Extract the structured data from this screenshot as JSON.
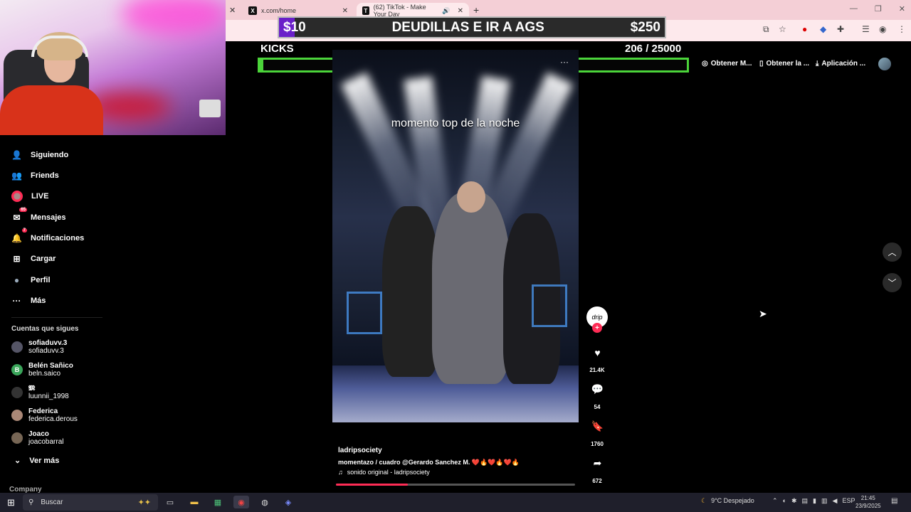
{
  "browser": {
    "tabs": [
      {
        "title": "x.com/home",
        "icon": "X"
      },
      {
        "title": "(62) TikTok - Make Your Day",
        "icon": "T"
      }
    ],
    "new_tab": "+",
    "close_side": "✕"
  },
  "donation_bar": {
    "left": "$10",
    "goal_text": "DEUDILLAS E IR A AGS",
    "right": "$250",
    "progress": 0.04
  },
  "kicks": {
    "label": "KICKS",
    "count": "206  / 25000",
    "progress": 0.008
  },
  "sidebar": {
    "items": [
      {
        "label": "Siguiendo",
        "icon": "person-icon",
        "glyph": "👤"
      },
      {
        "label": "Friends",
        "icon": "people-icon",
        "glyph": "👥"
      },
      {
        "label": "LIVE",
        "icon": "live-icon",
        "glyph": ""
      },
      {
        "label": "Mensajes",
        "icon": "message-icon",
        "glyph": "✉",
        "badge": "65"
      },
      {
        "label": "Notificaciones",
        "icon": "notification-icon",
        "glyph": "🔔",
        "badge": "7"
      },
      {
        "label": "Cargar",
        "icon": "upload-icon",
        "glyph": "⊞"
      },
      {
        "label": "Perfil",
        "icon": "profile-icon",
        "glyph": "●"
      },
      {
        "label": "Más",
        "icon": "more-icon",
        "glyph": "···"
      }
    ],
    "following_title": "Cuentas que sigues",
    "accounts": [
      {
        "name": "sofiaduvv.3",
        "handle": "sofiaduvv.3",
        "initial": ""
      },
      {
        "name": "Belén Sañico",
        "handle": "beln.saico",
        "initial": "B"
      },
      {
        "name": "𝕸",
        "handle": "luunnii_1998",
        "initial": ""
      },
      {
        "name": "Federica",
        "handle": "federica.derous",
        "initial": ""
      },
      {
        "name": "Joaco",
        "handle": "joacobarral",
        "initial": ""
      }
    ],
    "see_more": "Ver más",
    "company": "Company"
  },
  "video": {
    "overlay_caption": "momento top de la noche",
    "author": "ladripsociety",
    "description": "momentazo / cuadro @Gerardo Sanchez M.  ❤️🔥❤️🔥❤️🔥",
    "sound": "sonido original - ladripsociety",
    "progress": 0.3
  },
  "actions": {
    "avatar_text": "drip",
    "likes": "21.4K",
    "comments": "54",
    "saves": "1760",
    "shares": "672"
  },
  "top_links": {
    "coins": "Obtener M...",
    "app": "Obtener la ...",
    "desktop": "Aplicación ..."
  },
  "taskbar": {
    "search_placeholder": "Buscar",
    "weather": "9°C  Despejado",
    "lang": "ESP",
    "time": "21:45",
    "date": "23/9/2025"
  }
}
